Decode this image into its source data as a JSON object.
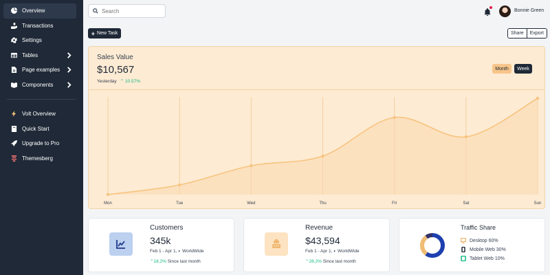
{
  "sidebar": {
    "items": [
      {
        "label": "Overview",
        "icon": "pie-chart-icon",
        "active": true
      },
      {
        "label": "Transactions",
        "icon": "hand-money-icon"
      },
      {
        "label": "Settings",
        "icon": "gear-icon"
      },
      {
        "label": "Tables",
        "icon": "table-icon",
        "chevron": true
      },
      {
        "label": "Page examples",
        "icon": "file-icon",
        "chevron": true
      },
      {
        "label": "Components",
        "icon": "box-icon",
        "chevron": true
      }
    ],
    "secondary": [
      {
        "label": "Volt Overview",
        "icon": "bolt-icon"
      },
      {
        "label": "Quick Start",
        "icon": "book-icon"
      },
      {
        "label": "Upgrade to Pro",
        "icon": "rocket-icon"
      },
      {
        "label": "Themesberg",
        "icon": "themesberg-logo-icon"
      }
    ]
  },
  "topbar": {
    "search_placeholder": "Search",
    "user_name": "Bonnie Green"
  },
  "actions": {
    "new_task": "New Task",
    "share": "Share",
    "export": "Export"
  },
  "sales": {
    "title": "Sales Value",
    "value": "$10,567",
    "period": "Yesterday",
    "change": "10.57%",
    "toggle_month": "Month",
    "toggle_week": "Week"
  },
  "chart_data": {
    "type": "line",
    "categories": [
      "Mon",
      "Tue",
      "Wed",
      "Thu",
      "Fri",
      "Sat",
      "Sun"
    ],
    "values": [
      0,
      10,
      30,
      40,
      80,
      60,
      100
    ],
    "ylim": [
      0,
      100
    ],
    "grid": "vertical",
    "color": "#f7c47f"
  },
  "cards": {
    "customers": {
      "title": "Customers",
      "value": "345k",
      "range": "Feb 1 - Apr 1,",
      "region": "WorldWide",
      "change": "18.2%",
      "since": "Since last month",
      "icon": "chart-line-icon"
    },
    "revenue": {
      "title": "Revenue",
      "value": "$43,594",
      "range": "Feb 1 - Apr 1,",
      "region": "WorldWide",
      "change": "28.2%",
      "since": "Since last month",
      "icon": "cash-register-icon"
    },
    "traffic": {
      "title": "Traffic Share",
      "legend": [
        {
          "label": "Desktop 60%",
          "value": 60,
          "color": "#1e40af",
          "icon": "desktop-icon"
        },
        {
          "label": "Mobile Web 30%",
          "value": 30,
          "color": "#f0bc74",
          "icon": "mobile-icon"
        },
        {
          "label": "Tablet Web 10%",
          "value": 10,
          "color": "#31316a",
          "icon": "tablet-icon"
        }
      ]
    }
  },
  "colors": {
    "sidebar_bg": "#1f2937",
    "accent_orange": "#f7c47f",
    "success": "#10b981",
    "alert_dot": "#e11d48"
  }
}
